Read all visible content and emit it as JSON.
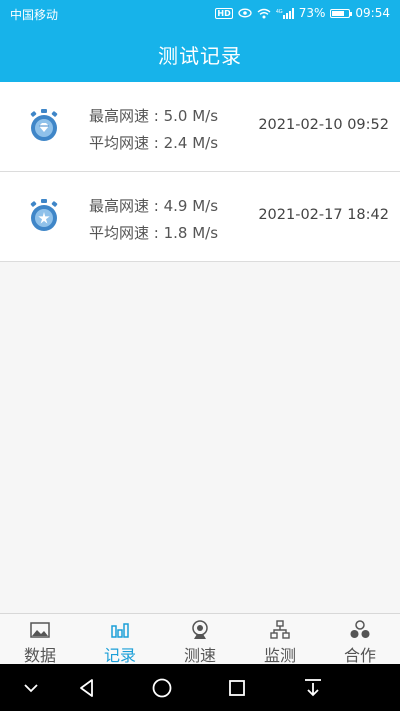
{
  "status_bar": {
    "carrier": "中国移动",
    "hd_badge": "HD",
    "network": "4G",
    "battery": "73%",
    "battery_level": 0.73,
    "time": "09:54"
  },
  "header": {
    "title": "测试记录"
  },
  "records": [
    {
      "max_speed": "最高网速 : 5.0 M/s",
      "avg_speed": "平均网速 : 2.4 M/s",
      "time": "2021-02-10 09:52"
    },
    {
      "max_speed": "最高网速 : 4.9 M/s",
      "avg_speed": "平均网速 : 1.8 M/s",
      "time": "2021-02-17 18:42"
    }
  ],
  "tabs": [
    {
      "label": "数据",
      "icon": "image-icon",
      "active": false
    },
    {
      "label": "记录",
      "icon": "bar-chart-icon",
      "active": true
    },
    {
      "label": "测速",
      "icon": "webcam-icon",
      "active": false
    },
    {
      "label": "监测",
      "icon": "network-icon",
      "active": false
    },
    {
      "label": "合作",
      "icon": "circles-icon",
      "active": false
    }
  ],
  "colors": {
    "accent": "#17b3ea",
    "tab_active": "#1c9fd8",
    "gauge": "#3f86c8"
  }
}
